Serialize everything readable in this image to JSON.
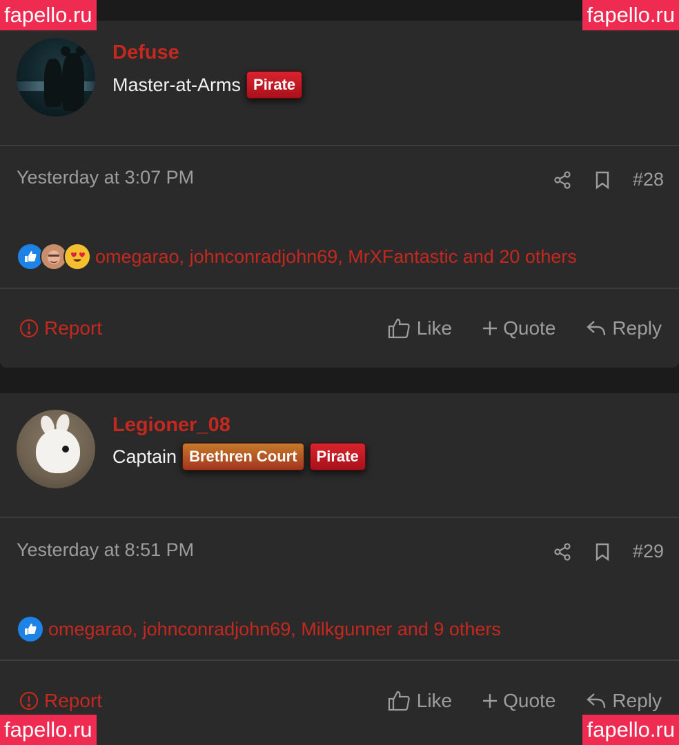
{
  "watermark": "fapello.ru",
  "posts": [
    {
      "username": "Defuse",
      "user_title": "Master-at-Arms",
      "badges": [
        "Pirate"
      ],
      "timestamp": "Yesterday at 3:07 PM",
      "post_number": "#28",
      "reactions_text": "omegarao, johnconradjohn69, MrXFantastic and 20 others",
      "reaction_icons": [
        "like-icon",
        "face-avatar-icon",
        "heart-eyes-emoji-icon"
      ]
    },
    {
      "username": "Legioner_08",
      "user_title": "Captain",
      "badges": [
        "Brethren Court",
        "Pirate"
      ],
      "timestamp": "Yesterday at 8:51 PM",
      "post_number": "#29",
      "reactions_text": "omegarao, johnconradjohn69, Milkgunner and 9 others",
      "reaction_icons": [
        "like-icon"
      ]
    }
  ],
  "actions": {
    "report": "Report",
    "like": "Like",
    "quote": "Quote",
    "reply": "Reply"
  },
  "colors": {
    "accent_red": "#c4281e",
    "background": "#1b1b1c",
    "card": "#2a2a2b",
    "watermark": "#ef2b52"
  }
}
